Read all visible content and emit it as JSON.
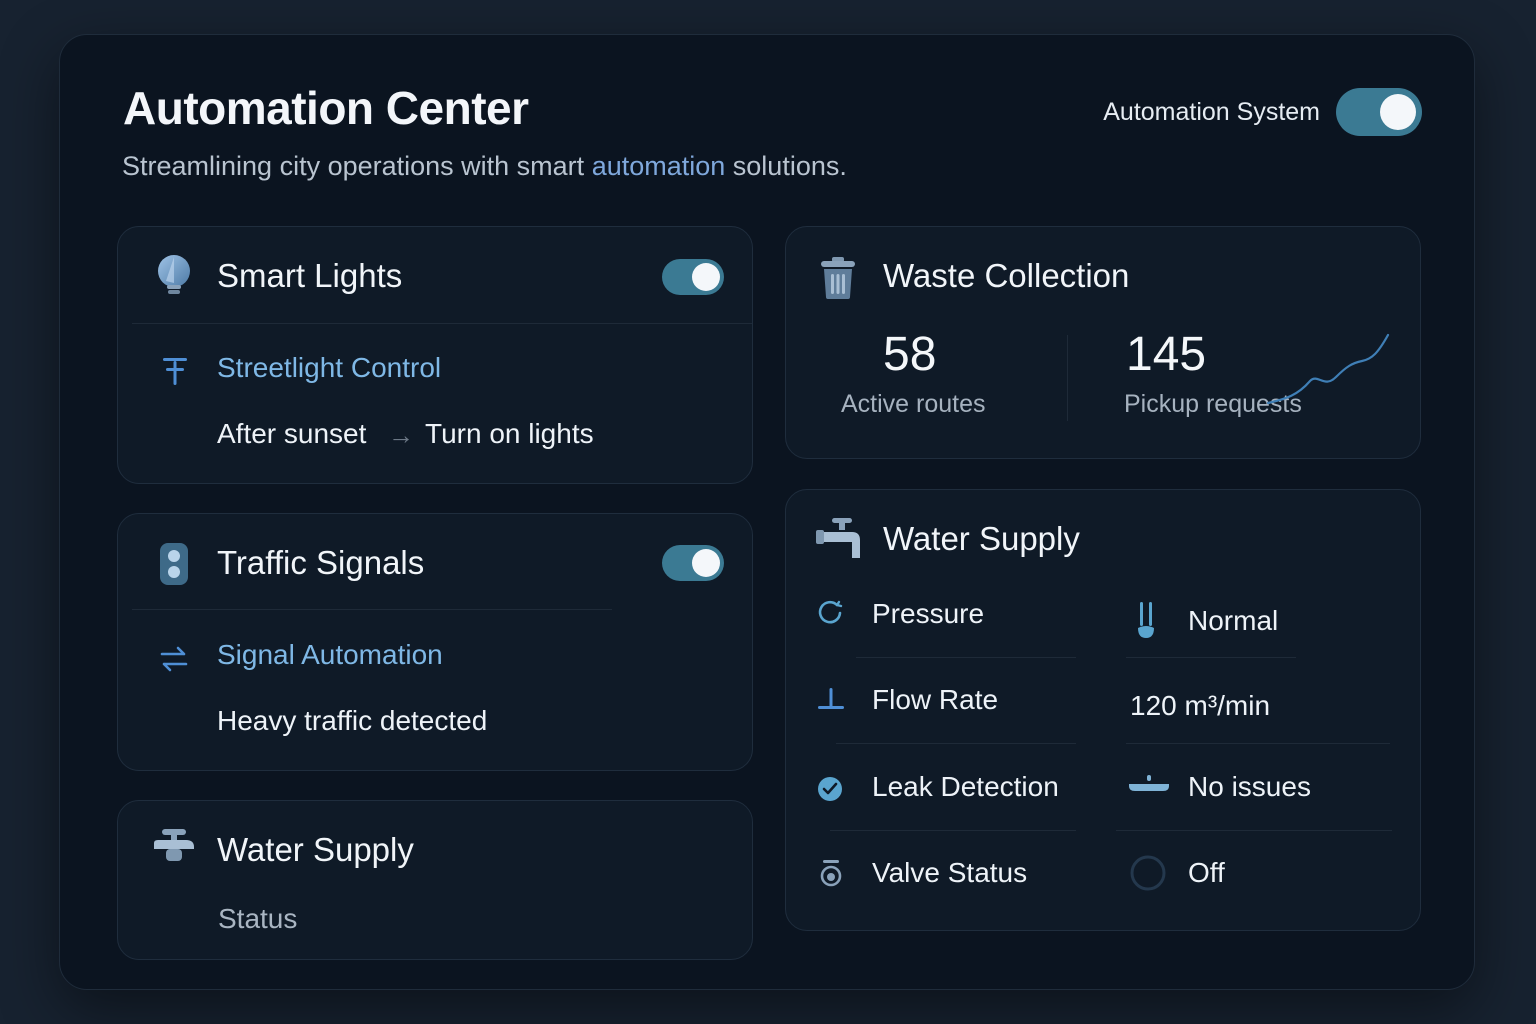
{
  "header": {
    "title": "Automation Center",
    "subtitle_before": "Streamlining city operations with smart ",
    "subtitle_highlight": "automation",
    "subtitle_after": " solutions.",
    "system_toggle_label": "Automation System",
    "system_toggle_on": true
  },
  "smart_lights": {
    "title": "Smart Lights",
    "toggle_on": true,
    "rule_title": "Streetlight Control",
    "condition": "After sunset",
    "action": "Turn on lights"
  },
  "traffic_signals": {
    "title": "Traffic Signals",
    "toggle_on": true,
    "rule_title": "Signal Automation",
    "condition": "Heavy traffic detected"
  },
  "water_supply_small": {
    "title": "Water Supply",
    "status_label": "Status"
  },
  "waste_collection": {
    "title": "Waste Collection",
    "active_routes_value": "58",
    "active_routes_label": "Active routes",
    "pickup_requests_value": "145",
    "pickup_requests_label": "Pickup requests"
  },
  "water_supply": {
    "title": "Water Supply",
    "rows": [
      {
        "label": "Pressure",
        "value": "Normal",
        "icon": "gauge-icon",
        "value_icon": "thermometer-icon"
      },
      {
        "label": "Flow Rate",
        "value": "120 m³/min",
        "icon": "flow-icon",
        "value_icon": ""
      },
      {
        "label": "Leak Detection",
        "value": "No issues",
        "icon": "check-circle-icon",
        "value_icon": "drop-icon"
      },
      {
        "label": "Valve Status",
        "value": "Off",
        "icon": "valve-icon",
        "value_icon": "ring-icon"
      }
    ]
  },
  "colors": {
    "accent": "#7fb8e6",
    "toggle": "#3b7a93",
    "panel": "#0b1420",
    "card": "#0f1a27"
  }
}
